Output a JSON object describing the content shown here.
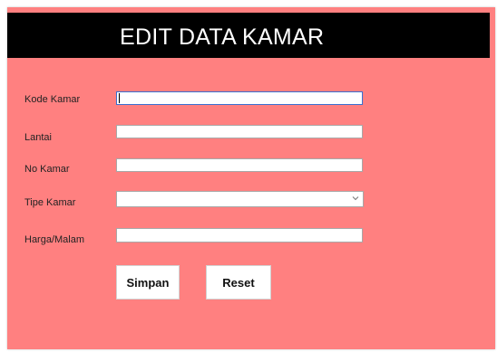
{
  "form": {
    "title": "EDIT DATA KAMAR",
    "fields": {
      "kode_kamar": {
        "label": "Kode Kamar",
        "value": ""
      },
      "lantai": {
        "label": "Lantai",
        "value": ""
      },
      "no_kamar": {
        "label": "No Kamar",
        "value": ""
      },
      "tipe_kamar": {
        "label": "Tipe Kamar",
        "value": ""
      },
      "harga_malam": {
        "label": "Harga/Malam",
        "value": ""
      }
    },
    "buttons": {
      "simpan": "Simpan",
      "reset": "Reset"
    }
  },
  "colors": {
    "background": "#ff8080",
    "header": "#000000",
    "title_text": "#ffffff",
    "focus_border": "#3a6fd0"
  },
  "icons": {
    "dropdown": "chevron-down-icon"
  }
}
